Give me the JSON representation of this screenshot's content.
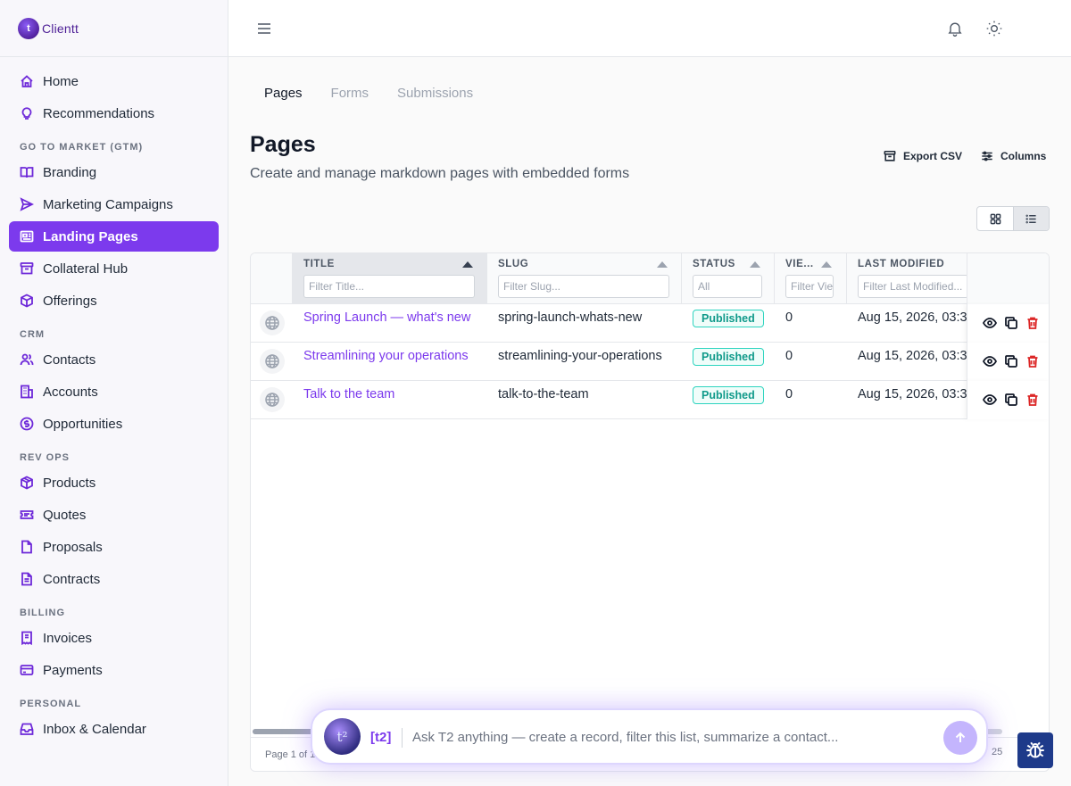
{
  "app": {
    "name": "Clientt",
    "logo_letter": "t"
  },
  "sidebar": {
    "top_items": [
      {
        "label": "Home",
        "icon": "home-icon"
      },
      {
        "label": "Recommendations",
        "icon": "lightbulb-icon"
      }
    ],
    "sections": [
      {
        "label": "GO TO MARKET (GTM)",
        "items": [
          {
            "label": "Branding",
            "icon": "book-icon"
          },
          {
            "label": "Marketing Campaigns",
            "icon": "send-icon"
          },
          {
            "label": "Landing Pages",
            "icon": "newspaper-icon",
            "active": true
          },
          {
            "label": "Collateral Hub",
            "icon": "archive-icon"
          },
          {
            "label": "Offerings",
            "icon": "box-icon"
          }
        ]
      },
      {
        "label": "CRM",
        "items": [
          {
            "label": "Contacts",
            "icon": "users-icon"
          },
          {
            "label": "Accounts",
            "icon": "building-icon"
          },
          {
            "label": "Opportunities",
            "icon": "dollar-icon"
          }
        ]
      },
      {
        "label": "REV OPS",
        "items": [
          {
            "label": "Products",
            "icon": "package-icon"
          },
          {
            "label": "Quotes",
            "icon": "ticket-icon"
          },
          {
            "label": "Proposals",
            "icon": "file-icon"
          },
          {
            "label": "Contracts",
            "icon": "file-text-icon"
          }
        ]
      },
      {
        "label": "BILLING",
        "items": [
          {
            "label": "Invoices",
            "icon": "receipt-icon"
          },
          {
            "label": "Payments",
            "icon": "credit-card-icon"
          }
        ]
      },
      {
        "label": "PERSONAL",
        "items": [
          {
            "label": "Inbox & Calendar",
            "icon": "inbox-icon"
          }
        ]
      }
    ]
  },
  "tabs": [
    {
      "label": "Pages",
      "active": true
    },
    {
      "label": "Forms",
      "active": false
    },
    {
      "label": "Submissions",
      "active": false
    }
  ],
  "page": {
    "title": "Pages",
    "subtitle": "Create and manage markdown pages with embedded forms",
    "export_label": "Export CSV",
    "columns_label": "Columns"
  },
  "table": {
    "columns": [
      {
        "key": "title",
        "label": "TITLE",
        "placeholder": "Filter Title..."
      },
      {
        "key": "slug",
        "label": "SLUG",
        "placeholder": "Filter Slug..."
      },
      {
        "key": "status",
        "label": "STATUS",
        "placeholder": "All"
      },
      {
        "key": "views",
        "label": "VIE...",
        "placeholder": "Filter Views"
      },
      {
        "key": "modified",
        "label": "LAST MODIFIED",
        "placeholder": "Filter Last Modified..."
      }
    ],
    "rows": [
      {
        "title": "Spring Launch — what's new",
        "slug": "spring-launch-whats-new",
        "status": "Published",
        "views": "0",
        "modified": "Aug 15, 2026, 03:3"
      },
      {
        "title": "Streamlining your operations",
        "slug": "streamlining-your-operations",
        "status": "Published",
        "views": "0",
        "modified": "Aug 15, 2026, 03:3"
      },
      {
        "title": "Talk to the team",
        "slug": "talk-to-the-team",
        "status": "Published",
        "views": "0",
        "modified": "Aug 15, 2026, 03:3"
      }
    ],
    "footer": {
      "page_info": "Page 1 of 1",
      "page_size": "25"
    }
  },
  "assistant": {
    "avatar_text": "t²",
    "tag": "[t2]",
    "placeholder": "Ask T2 anything — create a record, filter this list, summarize a contact..."
  },
  "colors": {
    "accent": "#7c3aed",
    "published": "#0f9a8a",
    "danger": "#dc2626"
  }
}
